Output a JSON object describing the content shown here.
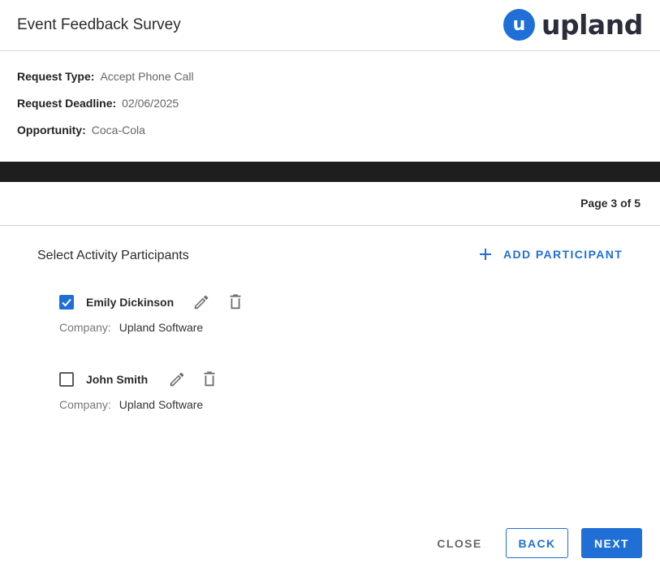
{
  "header": {
    "title": "Event Feedback Survey",
    "logo_mark": "u",
    "logo_text": "upland"
  },
  "info": [
    {
      "label": "Request Type:",
      "value": "Accept Phone Call"
    },
    {
      "label": "Request Deadline:",
      "value": "02/06/2025"
    },
    {
      "label": "Opportunity:",
      "value": "Coca-Cola"
    }
  ],
  "page_indicator": "Page 3 of 5",
  "section": {
    "title": "Select Activity Participants",
    "add_label": "ADD PARTICIPANT"
  },
  "participants": [
    {
      "name": "Emily Dickinson",
      "checked": true,
      "company_label": "Company:",
      "company": "Upland Software"
    },
    {
      "name": "John Smith",
      "checked": false,
      "company_label": "Company:",
      "company": "Upland Software"
    }
  ],
  "footer": {
    "close_label": "CLOSE",
    "back_label": "BACK",
    "next_label": "NEXT"
  },
  "colors": {
    "accent": "#1f6fd6",
    "dark_bar": "#1e1e1e"
  }
}
